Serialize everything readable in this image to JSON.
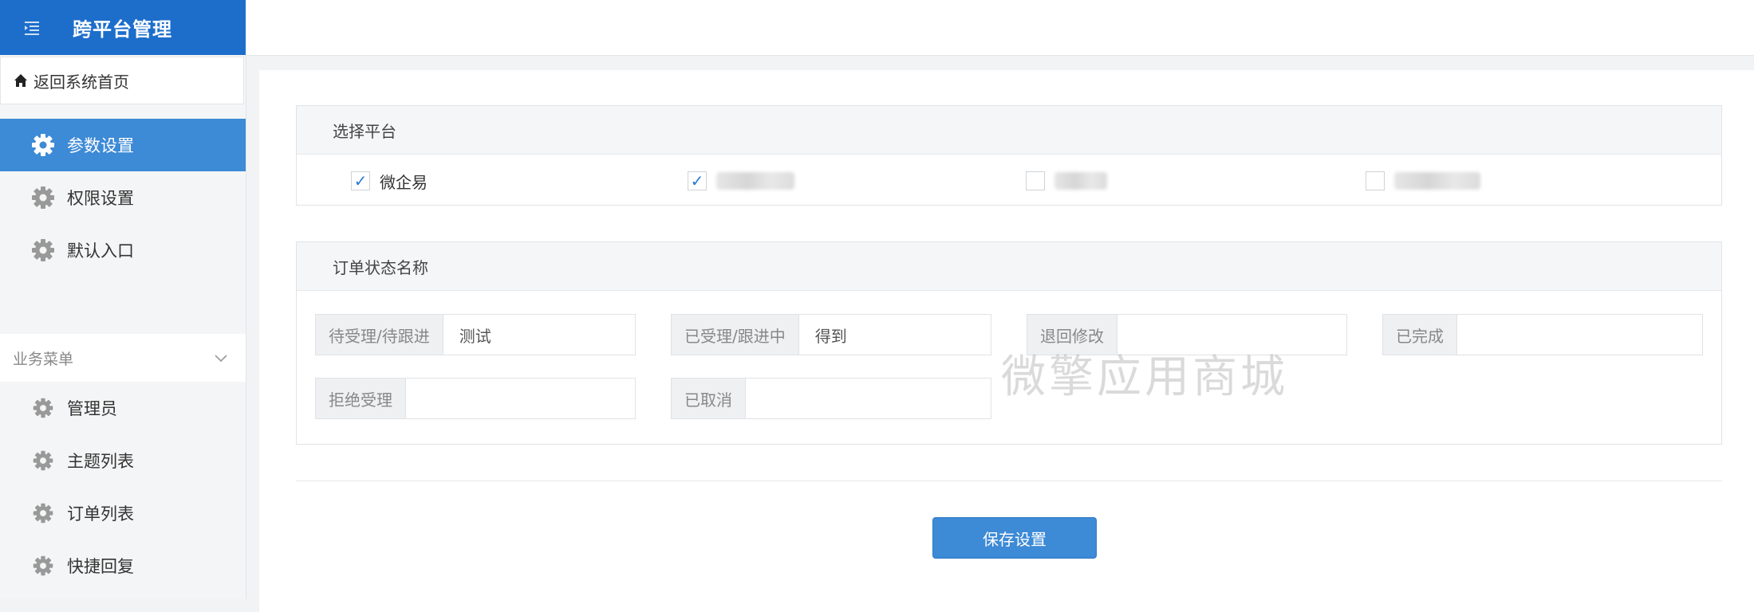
{
  "app": {
    "title": "跨平台管理"
  },
  "sidebar": {
    "home_label": "返回系统首页",
    "items": [
      {
        "label": "参数设置",
        "active": true
      },
      {
        "label": "权限设置"
      },
      {
        "label": "默认入口"
      }
    ],
    "group": {
      "label": "业务菜单",
      "items": [
        {
          "label": "管理员"
        },
        {
          "label": "主题列表"
        },
        {
          "label": "订单列表"
        },
        {
          "label": "快捷回复"
        }
      ]
    }
  },
  "platform_panel": {
    "title": "选择平台",
    "options": [
      {
        "label": "微企易",
        "checked": true
      },
      {
        "label": "",
        "checked": true,
        "obscured": true
      },
      {
        "label": "",
        "checked": false,
        "obscured": true
      },
      {
        "label": "",
        "checked": false,
        "obscured": true
      }
    ],
    "check_mark": "✓"
  },
  "status_panel": {
    "title": "订单状态名称",
    "fields": [
      {
        "label": "待受理/待跟进",
        "value": "测试"
      },
      {
        "label": "已受理/跟进中",
        "value": "得到"
      },
      {
        "label": "退回修改",
        "value": ""
      },
      {
        "label": "已完成",
        "value": ""
      },
      {
        "label": "拒绝受理",
        "value": ""
      },
      {
        "label": "已取消",
        "value": ""
      }
    ]
  },
  "actions": {
    "save_label": "保存设置"
  },
  "watermark": "微擎应用商城",
  "colors": {
    "brand": "#1d6ecb",
    "active": "#3d8ad6",
    "check": "#2b7bd1"
  }
}
